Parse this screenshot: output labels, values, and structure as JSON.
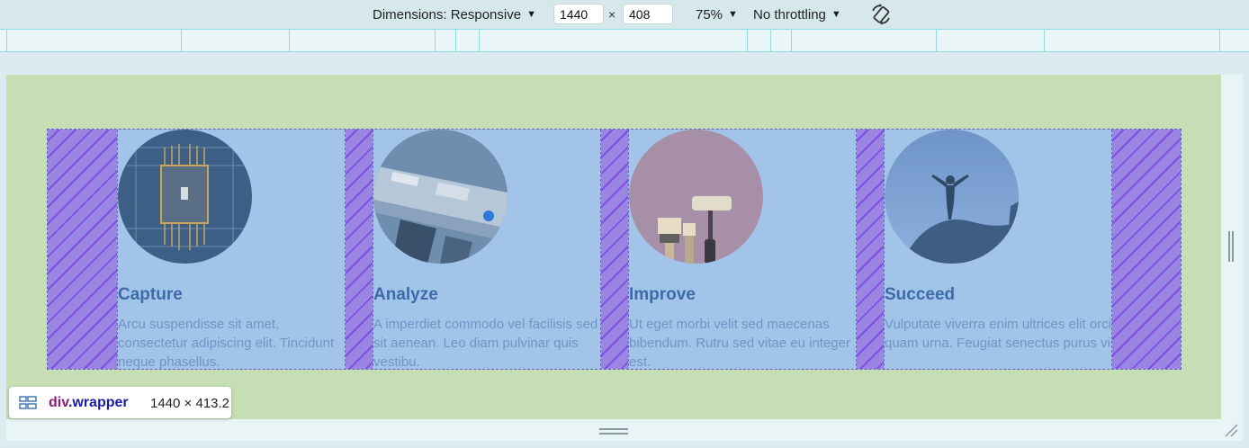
{
  "toolbar": {
    "dimensions_label": "Dimensions: Responsive",
    "width_value": "1440",
    "height_value": "408",
    "times_symbol": "×",
    "zoom_label": "75%",
    "throttling_label": "No throttling",
    "caret": "▼",
    "rotate_icon": "rotate-icon"
  },
  "cards": [
    {
      "title": "Capture",
      "text": "Arcu suspendisse sit amet, consectetur adipiscing elit. Tincidunt neque phasellus.",
      "image": "circuit-board"
    },
    {
      "title": "Analyze",
      "text": "A imperdiet commodo vel facilisis sed sit aenean. Leo diam pulvinar quis vestibu.",
      "image": "desk-workspace"
    },
    {
      "title": "Improve",
      "text": "Ut eget morbi velit sed maecenas bibendum. Rutru sed vitae eu integer est.",
      "image": "paint-tools"
    },
    {
      "title": "Succeed",
      "text": "Vulputate viverra enim ultrices elit orci quam urna. Feugiat senectus purus vi.",
      "image": "person-on-summit"
    }
  ],
  "tooltip": {
    "tag": "div",
    "class_name": ".wrapper",
    "size": "1440 × 413.2",
    "icon": "grid-layout-icon"
  },
  "colors": {
    "viewport_bg": "#c5deb3",
    "wrapper_bg": "#a9c8eb",
    "gap_hatch": "#9a86e2",
    "title": "#3e6aa8",
    "text": "#6f95c7"
  }
}
